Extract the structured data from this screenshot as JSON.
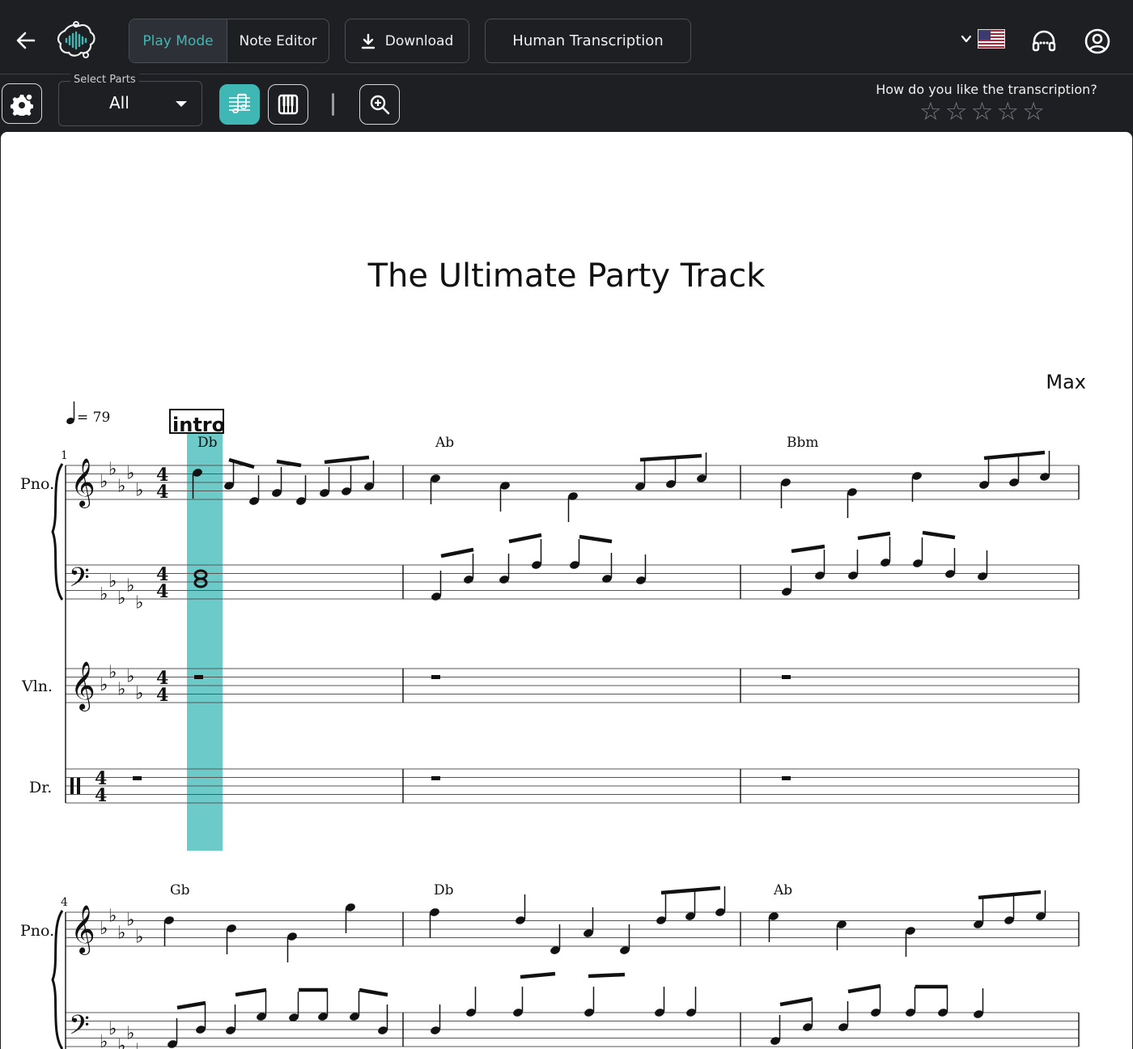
{
  "header": {
    "modes": [
      "Play Mode",
      "Note Editor"
    ],
    "active_mode": "Play Mode",
    "download_label": "Download",
    "human_transcription_label": "Human Transcription",
    "language": "en-US"
  },
  "toolbar": {
    "select_parts_label": "Select Parts",
    "select_parts_value": "All",
    "rating_question": "How do you like the transcription?",
    "rating_value": 0,
    "rating_max": 5
  },
  "score": {
    "title": "The Ultimate Party Track",
    "composer": "Max",
    "tempo_text": "= 79",
    "rehearsal_mark": "intro",
    "measure_number_1": "1",
    "measure_number_2": "4",
    "parts": [
      "Pno.",
      "Vln.",
      "Dr."
    ],
    "chords_system1": [
      "Db",
      "Ab",
      "Bbm"
    ],
    "chords_system2": [
      "Gb",
      "Db",
      "Ab"
    ],
    "time_signature": "4/4",
    "key_signature": "5 flats",
    "playhead_color": "#6ccac9",
    "accent_color": "#3fb7b4"
  }
}
